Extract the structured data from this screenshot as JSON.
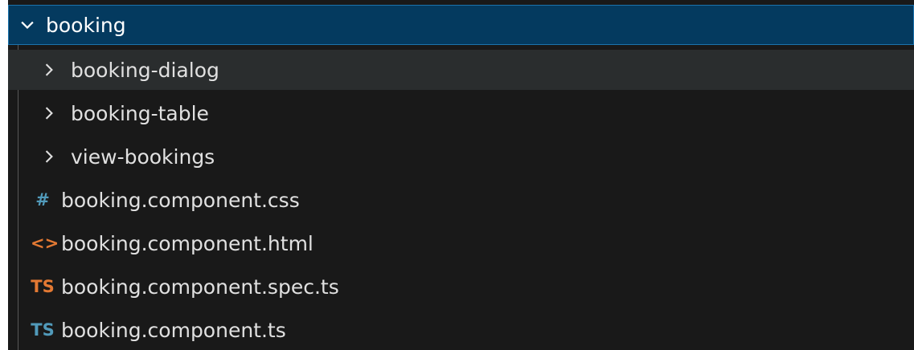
{
  "explorer": {
    "folder": {
      "name": "booking",
      "expanded": true
    },
    "items": [
      {
        "label": "booking-dialog",
        "kind": "folder",
        "icon": "chevron-right-icon"
      },
      {
        "label": "booking-table",
        "kind": "folder",
        "icon": "chevron-right-icon"
      },
      {
        "label": "view-bookings",
        "kind": "folder",
        "icon": "chevron-right-icon"
      },
      {
        "label": "booking.component.css",
        "kind": "file",
        "icon": "hash-icon",
        "icon_text": "#",
        "icon_color": "#519aba"
      },
      {
        "label": "booking.component.html",
        "kind": "file",
        "icon": "angle-brackets-icon",
        "icon_text": "<>",
        "icon_color": "#e37933"
      },
      {
        "label": "booking.component.spec.ts",
        "kind": "file",
        "icon": "typescript-icon",
        "icon_text": "TS",
        "icon_color": "#e37933"
      },
      {
        "label": "booking.component.ts",
        "kind": "file",
        "icon": "typescript-icon",
        "icon_text": "TS",
        "icon_color": "#519aba"
      }
    ]
  },
  "colors": {
    "background": "#191919",
    "selected_row": "#043a5f",
    "selected_border": "#1b73ad",
    "hover_row": "#2a2d2e",
    "text": "#e0e0e0"
  }
}
